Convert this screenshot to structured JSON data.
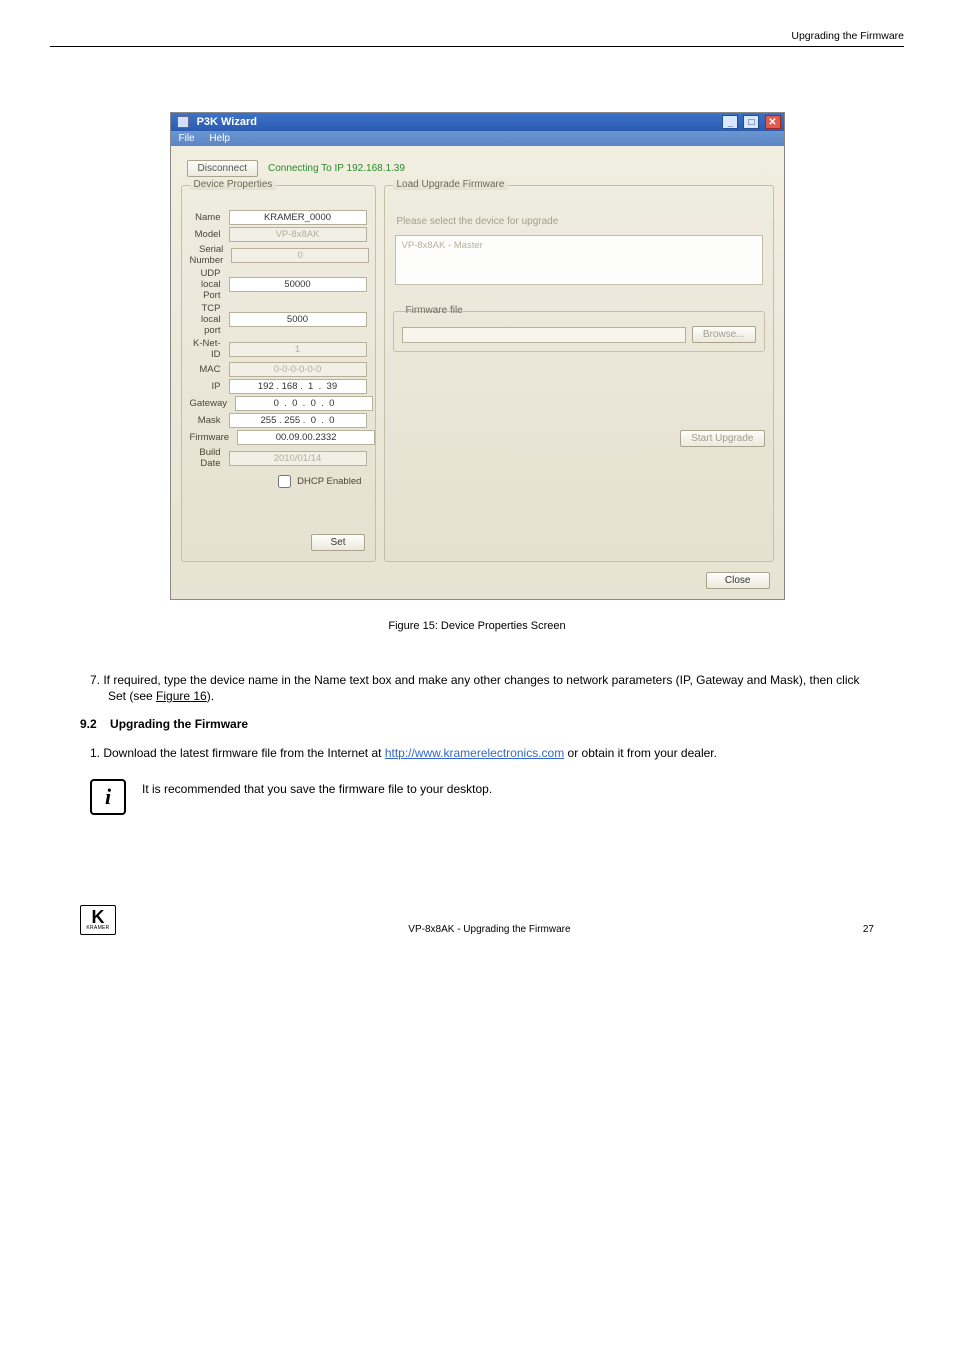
{
  "header": {
    "right": "Upgrading the Firmware"
  },
  "window": {
    "title": "P3K Wizard",
    "menu": {
      "file": "File",
      "help": "Help"
    },
    "controls": {
      "min": "_",
      "max": "□",
      "close": "✕"
    },
    "disconnect": "Disconnect",
    "status": "Connecting To IP 192.168.1.39",
    "leftPanel": {
      "legend": "Device Properties",
      "rows": {
        "name": {
          "label": "Name",
          "value": "KRAMER_0000",
          "disabled": false
        },
        "model": {
          "label": "Model",
          "value": "VP-8x8AK",
          "disabled": true
        },
        "serial": {
          "label": "Serial Number",
          "value": "0",
          "disabled": true
        },
        "udp": {
          "label": "UDP local Port",
          "value": "50000",
          "disabled": false
        },
        "tcp": {
          "label": "TCP local port",
          "value": "5000",
          "disabled": false
        },
        "knet": {
          "label": "K-Net-ID",
          "value": "1",
          "disabled": true
        },
        "mac": {
          "label": "MAC",
          "value": "0-0-0-0-0-0",
          "disabled": true
        },
        "ip": {
          "label": "IP",
          "value": "192 . 168 .  1  .  39",
          "disabled": false
        },
        "gateway": {
          "label": "Gateway",
          "value": "0  .  0  .  0  .  0",
          "disabled": false
        },
        "mask": {
          "label": "Mask",
          "value": "255 . 255 .  0  .  0",
          "disabled": false
        },
        "firmware": {
          "label": "Firmware",
          "value": "00.09.00.2332",
          "disabled": false
        },
        "build": {
          "label": "Build Date",
          "value": "2010/01/14",
          "disabled": true
        }
      },
      "dhcp": "DHCP Enabled",
      "setBtn": "Set"
    },
    "rightPanel": {
      "legend": "Load Upgrade Firmware",
      "hint": "Please select the device for upgrade",
      "deviceItem": "VP-8x8AK - Master",
      "firmwareFile": {
        "legend": "Firmware file",
        "browse": "Browse..."
      },
      "startUpgrade": "Start Upgrade"
    },
    "closeBtn": "Close"
  },
  "caption": "Figure 15: Device Properties Screen",
  "para1": "7.  If required, type the device name in the Name text box and make any other changes to network parameters (IP, Gateway and Mask), then click Set (see ",
  "figref": "Figure 16",
  "para1b": ").",
  "sectionNum": "9.2",
  "sectionTitle": "Upgrading the Firmware",
  "step1": "1.  Download the latest firmware file from the Internet at ",
  "link": "http://www.kramerelectronics.com",
  "step1b": " or obtain it from your dealer.",
  "note": "It is recommended that you save the firmware file to your desktop.",
  "noteGlyph": "i",
  "footer": {
    "text": "VP-8x8AK - Upgrading the Firmware",
    "page": "27",
    "logoSub": "KRAMER"
  }
}
